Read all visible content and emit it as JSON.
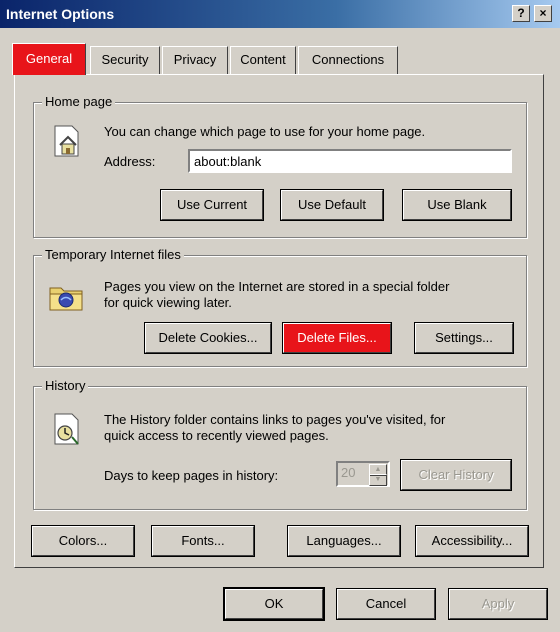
{
  "window": {
    "title": "Internet Options",
    "help_label": "?",
    "close_label": "×"
  },
  "tabs": [
    {
      "label": "General"
    },
    {
      "label": "Security"
    },
    {
      "label": "Privacy"
    },
    {
      "label": "Content"
    },
    {
      "label": "Connections"
    }
  ],
  "home_page": {
    "legend": "Home page",
    "description": "You can change which page to use for your home page.",
    "address_label": "Address:",
    "address_value": "about:blank",
    "buttons": {
      "use_current": "Use Current",
      "use_default": "Use Default",
      "use_blank": "Use Blank"
    }
  },
  "temp_files": {
    "legend": "Temporary Internet files",
    "description_line1": "Pages you view on the Internet are stored in a special folder",
    "description_line2": "for quick viewing later.",
    "buttons": {
      "delete_cookies": "Delete Cookies...",
      "delete_files": "Delete Files...",
      "settings": "Settings..."
    }
  },
  "history": {
    "legend": "History",
    "description_line1": "The History folder contains links to pages you've visited, for",
    "description_line2": "quick access to recently viewed pages.",
    "days_label": "Days to keep pages in history:",
    "days_value": "20",
    "clear_button": "Clear History"
  },
  "bottom_buttons": {
    "colors": "Colors...",
    "fonts": "Fonts...",
    "languages": "Languages...",
    "accessibility": "Accessibility..."
  },
  "dialog_buttons": {
    "ok": "OK",
    "cancel": "Cancel",
    "apply": "Apply"
  },
  "colors": {
    "highlight": "#e8141a",
    "title_start": "#0a246a",
    "title_end": "#a6caf0",
    "face": "#d4d0c8"
  },
  "icons": {
    "home": "home-page-icon",
    "temp_files": "temp-files-icon",
    "history": "history-icon"
  }
}
